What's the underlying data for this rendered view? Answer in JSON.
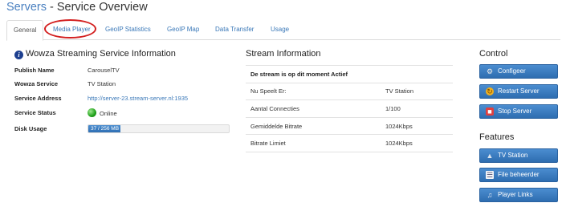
{
  "header": {
    "breadcrumb": "Servers",
    "title_sep": " - ",
    "title": "Service Overview"
  },
  "tabs": [
    {
      "label": "General",
      "active": true
    },
    {
      "label": "Media Player",
      "highlighted": true
    },
    {
      "label": "GeoIP Statistics"
    },
    {
      "label": "GeoIP Map"
    },
    {
      "label": "Data Transfer"
    },
    {
      "label": "Usage"
    }
  ],
  "wowza": {
    "title": "Wowza Streaming Service Information",
    "rows": [
      {
        "label": "Publish Name",
        "value": "CarouselTV"
      },
      {
        "label": "Wowza Service",
        "value": "TV Station"
      },
      {
        "label": "Service Address",
        "value": "http://server-23.stream-server.nl:1935"
      },
      {
        "label": "Service Status",
        "value": "Online",
        "status_color": "#1fa11a"
      },
      {
        "label": "Disk Usage",
        "value": "37 / 256 MB",
        "used": 37,
        "total": 256
      }
    ]
  },
  "stream": {
    "title": "Stream Information",
    "notice": "De stream is op dit moment Actief",
    "rows": [
      {
        "label": "Nu Speelt Er:",
        "value": "TV Station"
      },
      {
        "label": "Aantal Connecties",
        "value": "1/100"
      },
      {
        "label": "Gemiddelde Bitrate",
        "value": "1024Kbps"
      },
      {
        "label": "Bitrate Limiet",
        "value": "1024Kbps"
      }
    ]
  },
  "control": {
    "title": "Control",
    "buttons": [
      {
        "label": "Configeer",
        "icon": "gear-icon"
      },
      {
        "label": "Restart Server",
        "icon": "restart-icon"
      },
      {
        "label": "Stop Server",
        "icon": "stop-icon"
      }
    ]
  },
  "features": {
    "title": "Features",
    "buttons": [
      {
        "label": "TV Station",
        "icon": "antenna-icon"
      },
      {
        "label": "File beheerder",
        "icon": "file-icon"
      },
      {
        "label": "Player Links",
        "icon": "music-note-icon"
      }
    ]
  },
  "colors": {
    "accent": "#3a78b8",
    "button": "#2e6db0",
    "highlight_ring": "#d32020",
    "online": "#1fa11a"
  }
}
